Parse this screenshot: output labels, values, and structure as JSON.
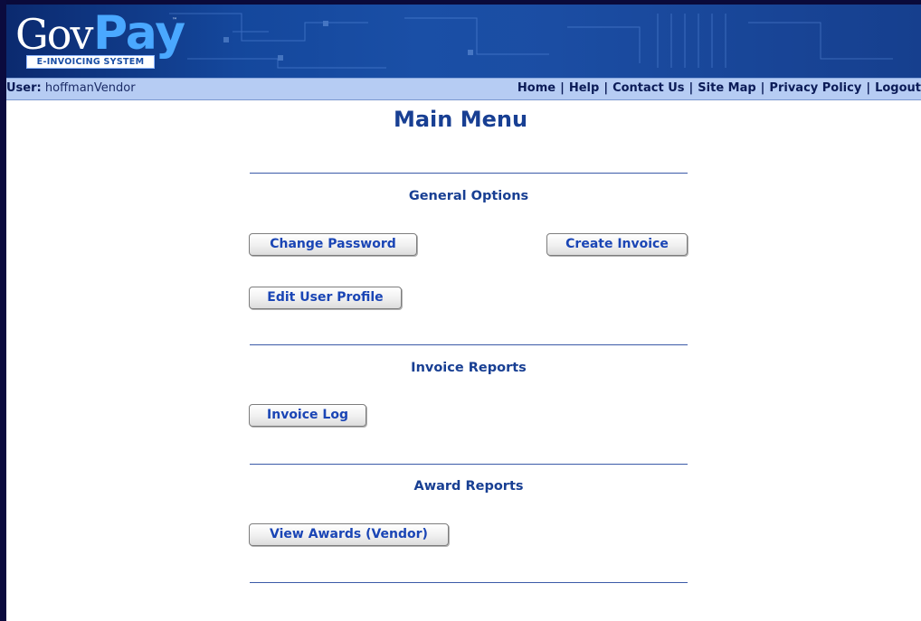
{
  "header": {
    "logo": {
      "gov": "Gov",
      "pay": "Pay",
      "subtitle": "E-INVOICING SYSTEM",
      "tm": "™"
    },
    "user_label": "User:",
    "username": "hoffmanVendor",
    "nav": [
      "Home",
      "Help",
      "Contact Us",
      "Site Map",
      "Privacy Policy",
      "Logout"
    ]
  },
  "main": {
    "title": "Main Menu",
    "sections": [
      {
        "title": "General Options",
        "buttons": [
          "Change Password",
          "Create Invoice",
          "Edit User Profile"
        ]
      },
      {
        "title": "Invoice Reports",
        "buttons": [
          "Invoice Log"
        ]
      },
      {
        "title": "Award Reports",
        "buttons": [
          "View Awards (Vendor)"
        ]
      }
    ]
  },
  "colors": {
    "banner": "#1a4fa6",
    "userbar": "#b6ccf3",
    "heading": "#183f93",
    "button_text": "#1a45b5"
  }
}
